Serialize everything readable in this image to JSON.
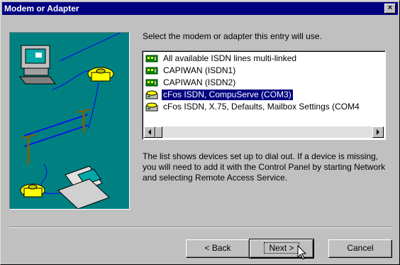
{
  "window": {
    "title": "Modem or Adapter",
    "close_glyph": "×"
  },
  "prompt": "Select the modem or adapter this entry will use.",
  "list": {
    "items": [
      {
        "label": "All available ISDN lines multi-linked",
        "icon": "isdn-card-icon",
        "selected": false
      },
      {
        "label": "CAPIWAN (ISDN1)",
        "icon": "isdn-card-icon",
        "selected": false
      },
      {
        "label": "CAPIWAN (ISDN2)",
        "icon": "isdn-card-icon",
        "selected": false
      },
      {
        "label": "cFos ISDN, CompuServe (COM3)",
        "icon": "modem-phone-icon",
        "selected": true
      },
      {
        "label": "cFos ISDN, X.75, Defaults, Mailbox Settings (COM4",
        "icon": "modem-phone-icon",
        "selected": false
      }
    ]
  },
  "info": "The list shows devices set up to dial out.  If a device is missing, you will need to add it with the Control Panel by starting Network and selecting Remote Access Service.",
  "buttons": {
    "back": "< Back",
    "next": "Next >",
    "cancel": "Cancel"
  },
  "colors": {
    "title_bar": "#000080",
    "face": "#c0c0c0",
    "illustration_bg": "#008080",
    "selection": "#000080"
  }
}
